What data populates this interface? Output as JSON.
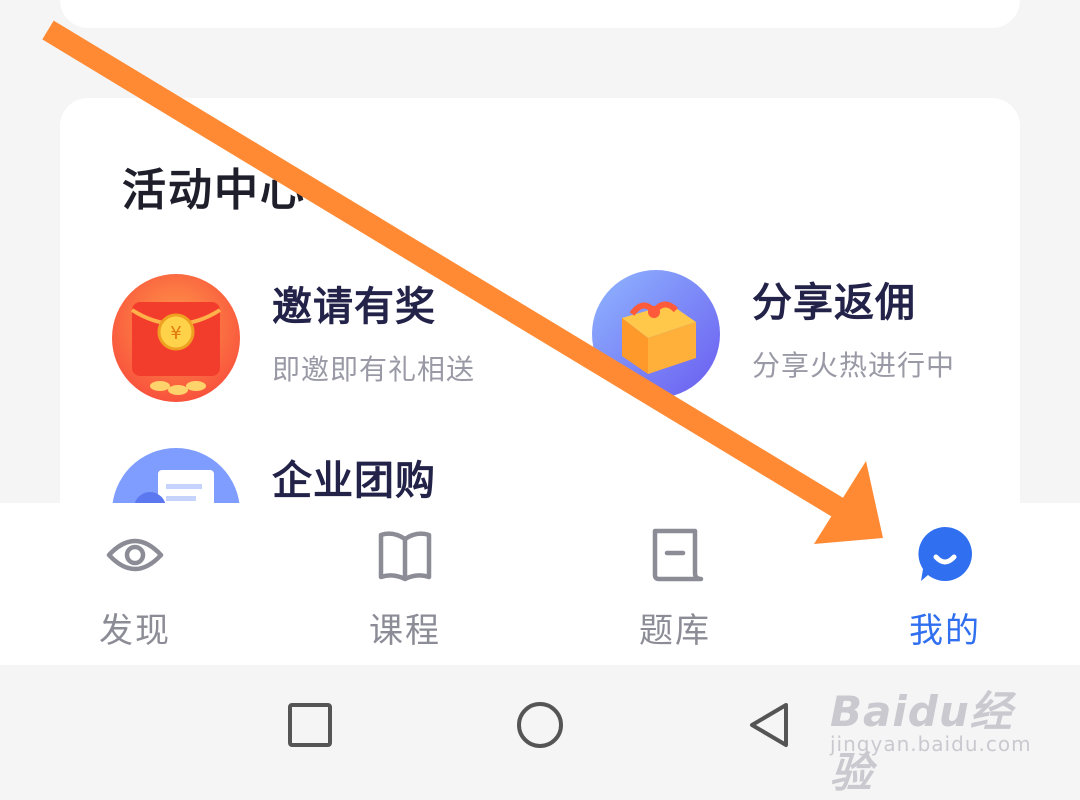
{
  "activity_center": {
    "title": "活动中心",
    "items": [
      {
        "title": "邀请有奖",
        "subtitle": "即邀即有礼相送",
        "icon": "red-envelope-icon"
      },
      {
        "title": "分享返佣",
        "subtitle": "分享火热进行中",
        "icon": "gift-box-icon"
      },
      {
        "title": "企业团购",
        "icon": "receipt-icon"
      }
    ]
  },
  "tabbar": {
    "tabs": [
      {
        "label": "发现",
        "icon": "eye-icon",
        "active": false
      },
      {
        "label": "课程",
        "icon": "book-icon",
        "active": false
      },
      {
        "label": "题库",
        "icon": "question-bank-icon",
        "active": false
      },
      {
        "label": "我的",
        "icon": "profile-icon",
        "active": true
      }
    ]
  },
  "system_nav": {
    "buttons": [
      "recent-apps",
      "home",
      "back"
    ]
  },
  "watermark": {
    "logo": "Baidu经验",
    "url": "jingyan.baidu.com"
  },
  "colors": {
    "accent": "#2f6ff0",
    "annotation_arrow": "#ff8a33",
    "title": "#23234a",
    "subtitle": "#9a9aa6"
  }
}
